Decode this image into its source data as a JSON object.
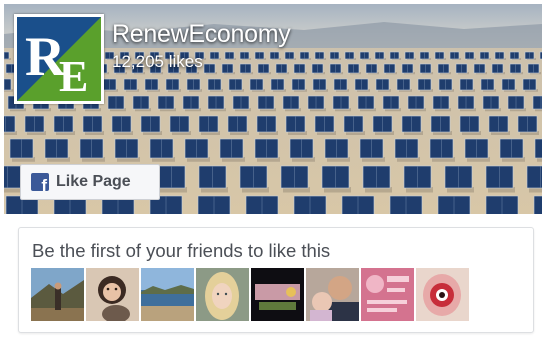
{
  "page": {
    "name": "RenewEconomy",
    "likes": "12,205 likes",
    "logo_text": "RE"
  },
  "like_button": {
    "label": "Like Page",
    "icon": "facebook-f-icon"
  },
  "friends": {
    "title": "Be the first of your friends to like this",
    "faces": [
      {
        "name": "friend-photo-1",
        "theme": "mountain-landscape"
      },
      {
        "name": "friend-photo-2",
        "theme": "woman-with-dog"
      },
      {
        "name": "friend-photo-3",
        "theme": "lake-shore"
      },
      {
        "name": "friend-photo-4",
        "theme": "blonde-woman"
      },
      {
        "name": "friend-photo-5",
        "theme": "dark-graphic"
      },
      {
        "name": "friend-photo-6",
        "theme": "man-with-baby"
      },
      {
        "name": "friend-photo-7",
        "theme": "pink-graphic"
      },
      {
        "name": "friend-photo-8",
        "theme": "red-eye-graphic"
      }
    ]
  },
  "colors": {
    "fb_blue": "#3b5998",
    "logo_blue": "#1a4f8b",
    "logo_green": "#5aa02c",
    "text_dark": "#4b4f56",
    "border": "#dddfe2"
  }
}
